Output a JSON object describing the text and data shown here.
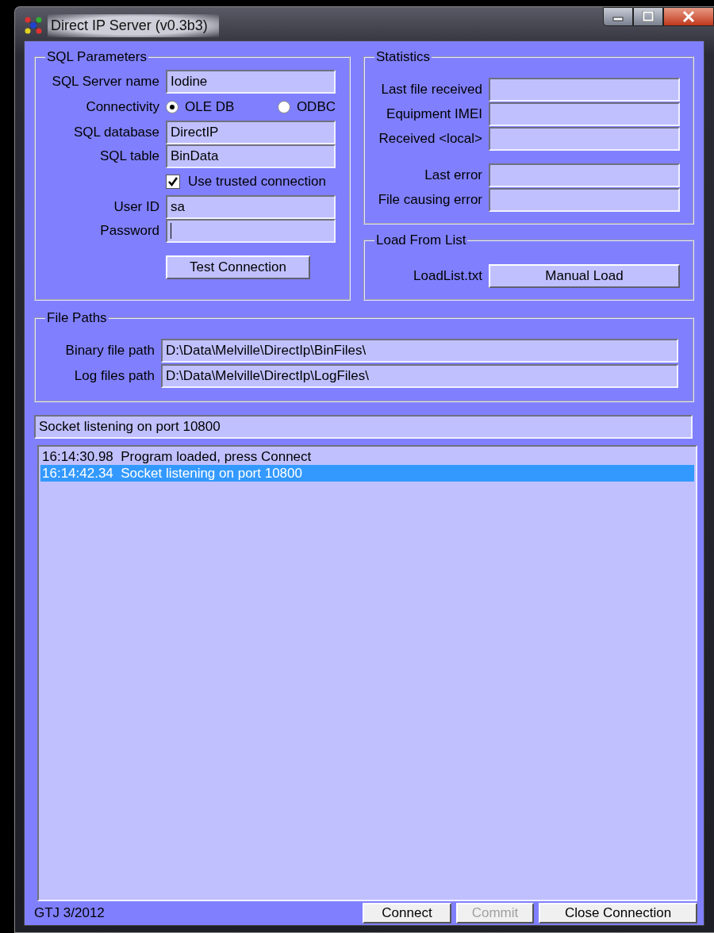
{
  "window": {
    "title": "Direct IP Server (v0.3b3)"
  },
  "sql_parameters": {
    "title": "SQL Parameters",
    "server_name": {
      "label": "SQL Server name",
      "value": "Iodine"
    },
    "connectivity": {
      "label": "Connectivity",
      "options": [
        {
          "label": "OLE DB",
          "selected": true
        },
        {
          "label": "ODBC",
          "selected": false
        }
      ]
    },
    "database": {
      "label": "SQL database",
      "value": "DirectIP"
    },
    "table": {
      "label": "SQL table",
      "value": "BinData"
    },
    "trusted": {
      "label": "Use trusted connection",
      "checked": true
    },
    "user_id": {
      "label": "User ID",
      "value": "sa"
    },
    "password": {
      "label": "Password",
      "focused": true
    },
    "test_button": "Test Connection"
  },
  "statistics": {
    "title": "Statistics",
    "groups": [
      [
        {
          "label": "Last file received"
        },
        {
          "label": "Equipment IMEI"
        },
        {
          "label": "Received <local>"
        }
      ],
      [
        {
          "label": "Last error"
        },
        {
          "label": "File causing error"
        }
      ]
    ]
  },
  "load_from_list": {
    "title": "Load From List",
    "label": "LoadList.txt",
    "button": "Manual Load"
  },
  "file_paths": {
    "title": "File Paths",
    "fields": [
      {
        "label": "Binary file path",
        "value": "D:\\Data\\Melville\\DirectIp\\BinFiles\\"
      },
      {
        "label": "Log files path",
        "value": "D:\\Data\\Melville\\DirectIp\\LogFiles\\"
      }
    ]
  },
  "status_field": "Socket listening on port 10800",
  "log": [
    {
      "time": "16:14:30.98",
      "message": "Program loaded, press Connect",
      "selected": false
    },
    {
      "time": "16:14:42.34",
      "message": "Socket listening on port 10800",
      "selected": true
    }
  ],
  "footer": {
    "text": "GTJ 3/2012",
    "buttons": [
      {
        "label": "Connect",
        "disabled": false
      },
      {
        "label": "Commit",
        "disabled": true
      },
      {
        "label": "Close Connection",
        "disabled": false
      }
    ]
  }
}
